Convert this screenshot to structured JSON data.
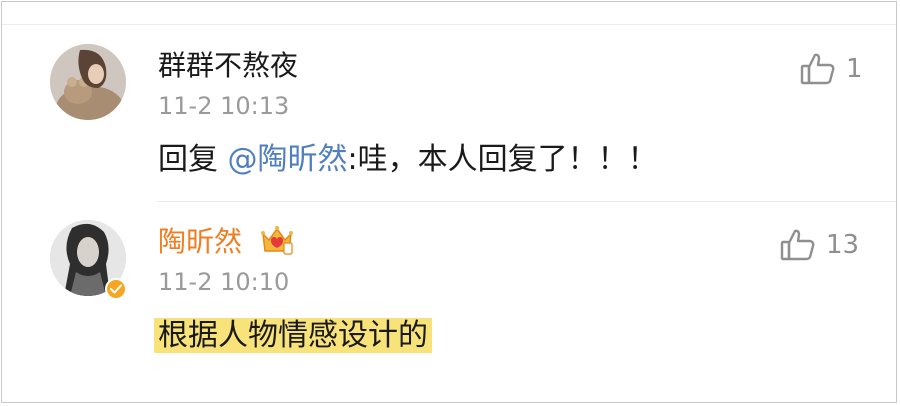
{
  "comments": [
    {
      "username": "群群不熬夜",
      "time": "11-2 10:13",
      "reply_prefix": "回复 ",
      "mention": "@陶昕然",
      "reply_text": ":哇，本人回复了！！！",
      "likes": "1"
    },
    {
      "username": "陶昕然",
      "time": "11-2 10:10",
      "content": "根据人物情感设计的",
      "likes": "13",
      "verified": true,
      "badge": "crown-vip-icon"
    }
  ],
  "colors": {
    "vip_name": "#f07d1f",
    "mention": "#4f7fbd",
    "highlight": "#f8e37b",
    "meta": "#9a9a9a"
  }
}
